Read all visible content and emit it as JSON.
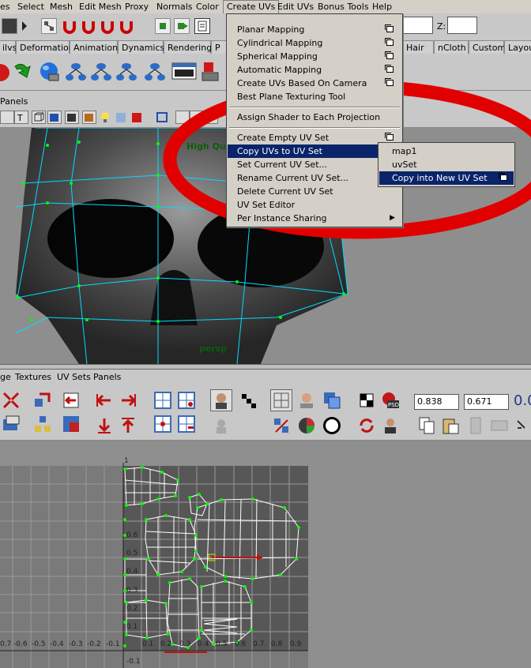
{
  "menubar": {
    "items": [
      "es",
      "Select",
      "Mesh",
      "Edit Mesh",
      "Proxy",
      "Normals",
      "Color",
      "Create UVs",
      "Edit UVs",
      "Bonus Tools",
      "Help"
    ]
  },
  "status": {
    "z_label": "Z:"
  },
  "shelf_tabs": [
    "ilvs",
    "Deformation",
    "Animation",
    "Dynamics",
    "Rendering",
    "P",
    "Hair",
    "nCloth",
    "Custom",
    "Layou"
  ],
  "panel_menu": "Panels",
  "viewport": {
    "hud_quality": "High Qu",
    "camera": "persp"
  },
  "create_uvs_menu": {
    "items": [
      {
        "label": "Planar Mapping",
        "option": true
      },
      {
        "label": "Cylindrical Mapping",
        "option": true
      },
      {
        "label": "Spherical Mapping",
        "option": true
      },
      {
        "label": "Automatic Mapping",
        "option": true
      },
      {
        "label": "Create UVs Based On Camera",
        "option": true
      },
      {
        "label": "Best Plane Texturing Tool",
        "option": false
      },
      {
        "label": "Assign Shader to Each Projection",
        "option": false
      },
      {
        "label": "Create Empty UV Set",
        "option": true
      },
      {
        "label": "Copy UVs to UV Set",
        "option": false,
        "submenu": true
      },
      {
        "label": "Set Current UV Set...",
        "option": false
      },
      {
        "label": "Rename Current UV Set...",
        "option": false
      },
      {
        "label": "Delete Current UV Set",
        "option": false
      },
      {
        "label": "UV Set Editor",
        "option": false
      },
      {
        "label": "Per Instance Sharing",
        "option": false,
        "submenu": true
      }
    ]
  },
  "copy_uvs_submenu": {
    "items": [
      "map1",
      "uvSet",
      "Copy into New UV Set"
    ]
  },
  "uv_editor": {
    "menu": [
      "ge",
      "Textures",
      "UV Sets",
      "Panels"
    ],
    "field_u": "0.838",
    "field_v": "0.671",
    "field_right": "0.0",
    "axis_x_labels": [
      "0.7",
      "-0.6",
      "-0.5",
      "-0.4",
      "-0.3",
      "-0.2",
      "-0.1",
      "0.1",
      "0.2",
      "0.3",
      "0.4",
      "0.5",
      "0.6",
      "0.7",
      "0.8",
      "0.9"
    ],
    "axis_y_labels": [
      "1",
      "0.6",
      "0.5",
      "0.4",
      "0.3",
      "0.2",
      "0.1",
      "-0.1"
    ]
  },
  "colors": {
    "highlight": "#0a246a",
    "annotation_ring": "#e00000",
    "uv_wire": "#ffffff",
    "uv_vertex": "#00ff00",
    "viewport_wire": "#00e5ff"
  }
}
